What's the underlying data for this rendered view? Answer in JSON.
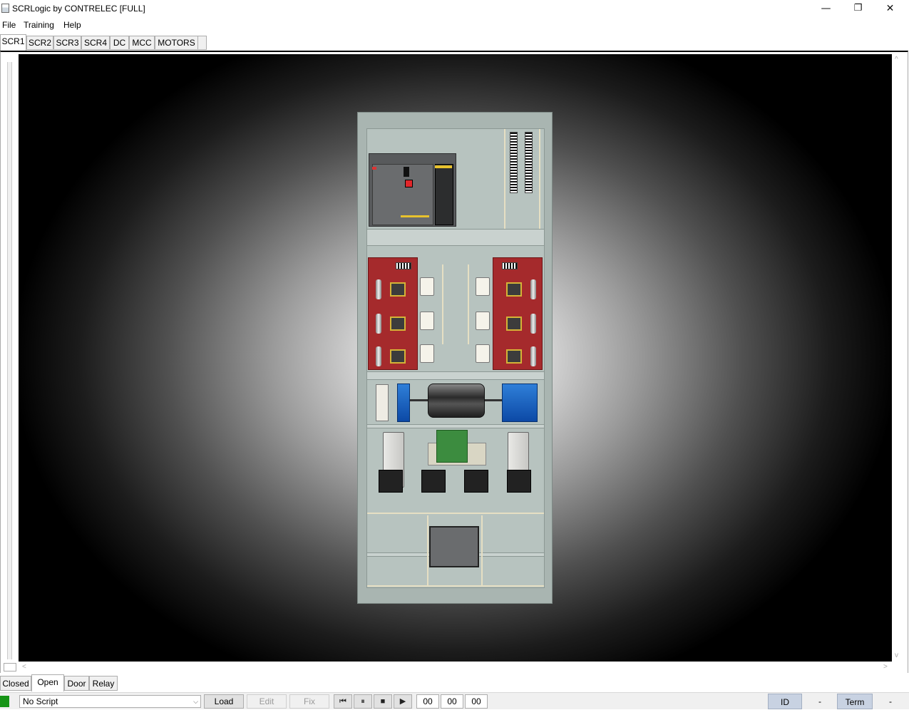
{
  "window": {
    "title": "SCRLogic by CONTRELEC [FULL]",
    "controls": {
      "minimize": "—",
      "maximize": "❐",
      "close": "✕"
    }
  },
  "menu": {
    "items": [
      "File",
      "Training",
      "Help"
    ]
  },
  "tabs": {
    "items": [
      "SCR1",
      "SCR2",
      "SCR3",
      "SCR4",
      "DC",
      "MCC",
      "MOTORS"
    ],
    "active": "SCR1"
  },
  "scroll": {
    "left_arrow": "<",
    "right_arrow": ">",
    "up_arrow": "^",
    "down_arrow": "v"
  },
  "view_tabs": {
    "items": [
      "Closed",
      "Open",
      "Door",
      "Relay"
    ],
    "active": "Open"
  },
  "status": {
    "indicator_color": "#169416",
    "script_select": "No Script",
    "buttons": {
      "load": "Load",
      "edit": "Edit",
      "fix": "Fix"
    },
    "playback": {
      "rewind": "⏮",
      "pause": "⏸",
      "stop": "■",
      "play": "▶"
    },
    "time": {
      "h": "00",
      "m": "00",
      "s": "00"
    },
    "id_label": "ID",
    "id_value": "-",
    "term_label": "Term",
    "term_value": "-"
  }
}
